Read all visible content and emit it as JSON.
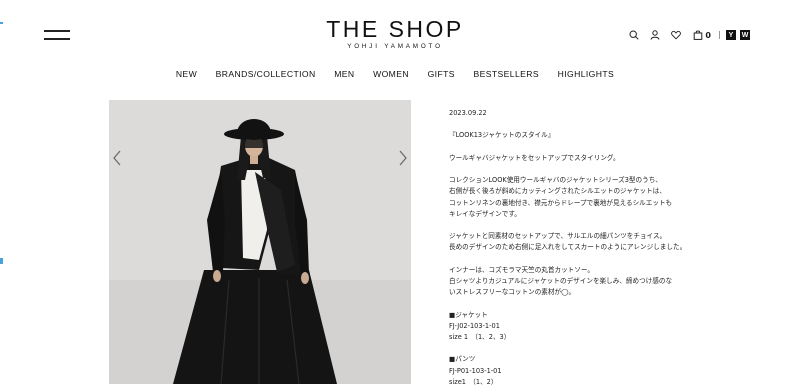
{
  "header": {
    "logo_title": "THE SHOP",
    "logo_subtitle": "YOHJI YAMAMOTO",
    "cart_count": "0",
    "brand_icons": [
      "Y",
      "W"
    ],
    "icons": [
      "search-icon",
      "user-icon",
      "heart-icon",
      "bag-icon"
    ]
  },
  "nav": {
    "items": [
      "NEW",
      "BRANDS/COLLECTION",
      "MEN",
      "WOMEN",
      "GIFTS",
      "BESTSELLERS",
      "HIGHLIGHTS"
    ]
  },
  "gallery": {
    "prev_icon": "chevron-left-icon",
    "next_icon": "chevron-right-icon"
  },
  "article": {
    "date": "2023.09.22",
    "heading": "『LOOK13ジャケットのスタイル』",
    "para1": [
      "ウールギャバジャケットをセットアップでスタイリング。"
    ],
    "para2": [
      "コレクションLOOK使用ウールギャバのジャケットシリーズ3型のうち、",
      "右側が長く後ろが斜めにカッティングされたシルエットのジャケットは、",
      "コットンリネンの裏地付き、襟元からドレープで裏地が見えるシルエットも",
      "キレイなデザインです。"
    ],
    "para3": [
      "ジャケットと同素材のセットアップで、サルエルの細パンツをチョイス。",
      "長めのデザインのため右側に足入れをしてスカートのようにアレンジしました。"
    ],
    "para4": [
      "インナーは、コズモラマ天竺の丸首カットソー。",
      "白シャツよりカジュアルにジャケットのデザインを楽しみ、締めつけ感のな",
      "いストレスフリーなコットンの素材が◯。"
    ],
    "item1": {
      "label": "■ジャケット",
      "code": "FJ-J02-103-1-01",
      "size": "size 1　（1、2、3）"
    },
    "item2": {
      "label": "■パンツ",
      "code": "FJ-P01-103-1-01",
      "size": "size1　（1、2）"
    }
  },
  "colors": {
    "edge_accent": "#4aa3d8",
    "photo_bg": "#d9d8d6",
    "text": "#1a1a1a"
  }
}
